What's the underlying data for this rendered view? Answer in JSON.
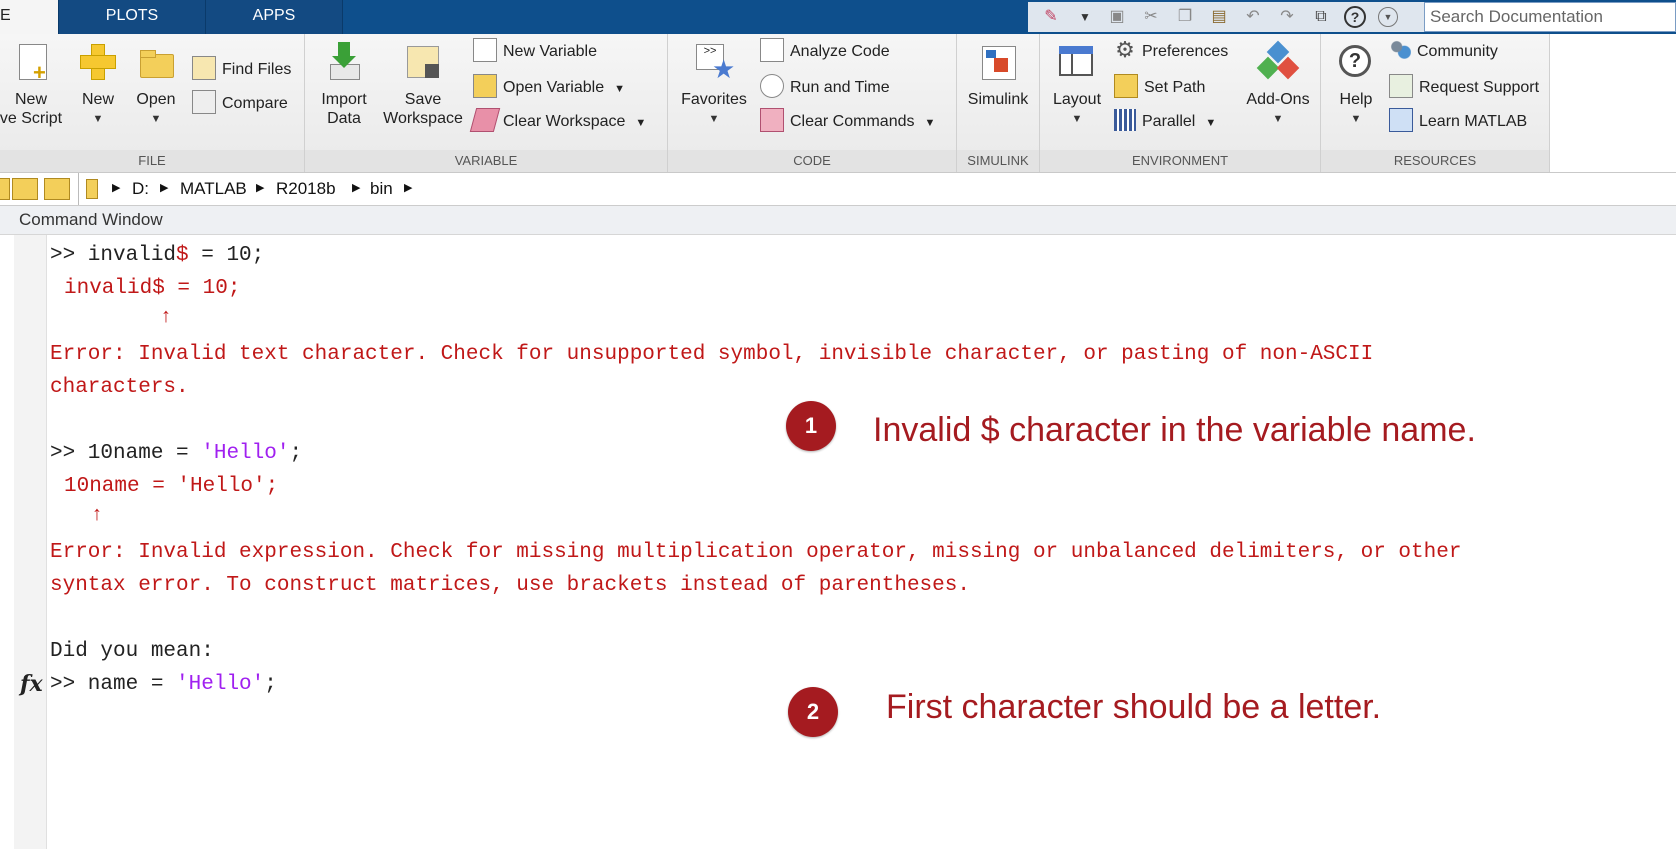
{
  "tabs": [
    {
      "label": "E",
      "active": true
    },
    {
      "label": "PLOTS",
      "active": false
    },
    {
      "label": "APPS",
      "active": false
    }
  ],
  "search": {
    "placeholder": "Search Documentation"
  },
  "ribbon": {
    "file": {
      "label": "FILE",
      "new_script": "New\nve Script",
      "new": "New",
      "open": "Open",
      "find_files": "Find Files",
      "compare": "Compare"
    },
    "variable": {
      "label": "VARIABLE",
      "import_data": "Import\nData",
      "save_workspace": "Save\nWorkspace",
      "new_variable": "New Variable",
      "open_variable": "Open Variable",
      "clear_workspace": "Clear Workspace"
    },
    "code": {
      "label": "CODE",
      "favorites": "Favorites",
      "analyze_code": "Analyze Code",
      "run_and_time": "Run and Time",
      "clear_commands": "Clear Commands"
    },
    "simulink": {
      "label": "SIMULINK",
      "simulink": "Simulink"
    },
    "environment": {
      "label": "ENVIRONMENT",
      "layout": "Layout",
      "preferences": "Preferences",
      "set_path": "Set Path",
      "parallel": "Parallel",
      "add_ons": "Add-Ons"
    },
    "resources": {
      "label": "RESOURCES",
      "help": "Help",
      "community": "Community",
      "request_support": "Request Support",
      "learn_matlab": "Learn MATLAB"
    }
  },
  "address": {
    "crumbs": [
      "D:",
      "MATLAB",
      "R2018b",
      "bin"
    ]
  },
  "command_window": {
    "title": "Command Window",
    "lines": {
      "l1_prompt": ">> invalid",
      "l1_dollar": "$",
      "l1_rest": " = 10;",
      "l2": "invalid$ = 10;",
      "l3": "Error: Invalid text character. Check for unsupported symbol, invisible character, or pasting of non-ASCII",
      "l4": "characters.",
      "l5_prompt": ">> 10name = ",
      "l5_str": "'Hello'",
      "l5_end": ";",
      "l6": "10name = 'Hello';",
      "l7": "Error: Invalid expression. Check for missing multiplication operator, missing or unbalanced delimiters, or other",
      "l8": "syntax error. To construct matrices, use brackets instead of parentheses.",
      "l9": "Did you mean:",
      "l10_prompt": ">> name = ",
      "l10_str": "'Hello'",
      "l10_end": ";"
    },
    "fx": "fx"
  },
  "annotations": [
    {
      "number": "1",
      "text": "Invalid $ character in the variable name."
    },
    {
      "number": "2",
      "text": "First character should be a letter."
    }
  ],
  "colors": {
    "tab_bar": "#0e4f8c",
    "error": "#c01818",
    "string": "#a020f0",
    "annotation": "#a51b20"
  }
}
